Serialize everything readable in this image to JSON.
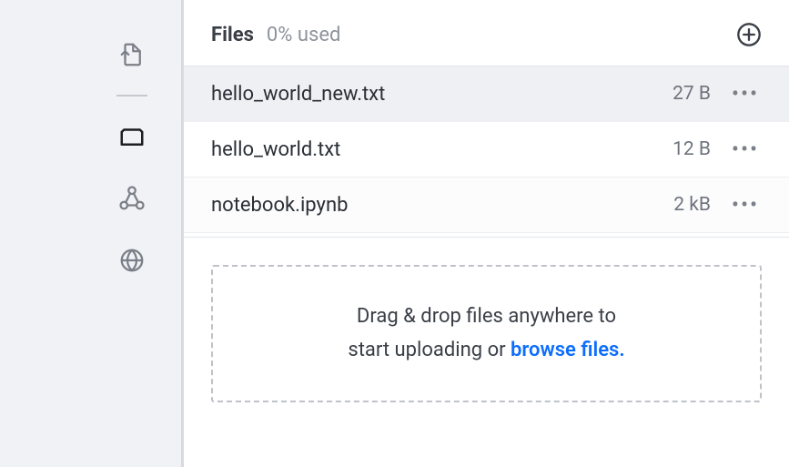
{
  "header": {
    "title": "Files",
    "usage": "0% used"
  },
  "files": [
    {
      "name": "hello_world_new.txt",
      "size": "27 B"
    },
    {
      "name": "hello_world.txt",
      "size": "12 B"
    },
    {
      "name": "notebook.ipynb",
      "size": "2 kB"
    }
  ],
  "dropzone": {
    "line1": "Drag & drop files anywhere to",
    "line2_prefix": "start uploading or ",
    "browse_label": "browse files",
    "period": "."
  }
}
